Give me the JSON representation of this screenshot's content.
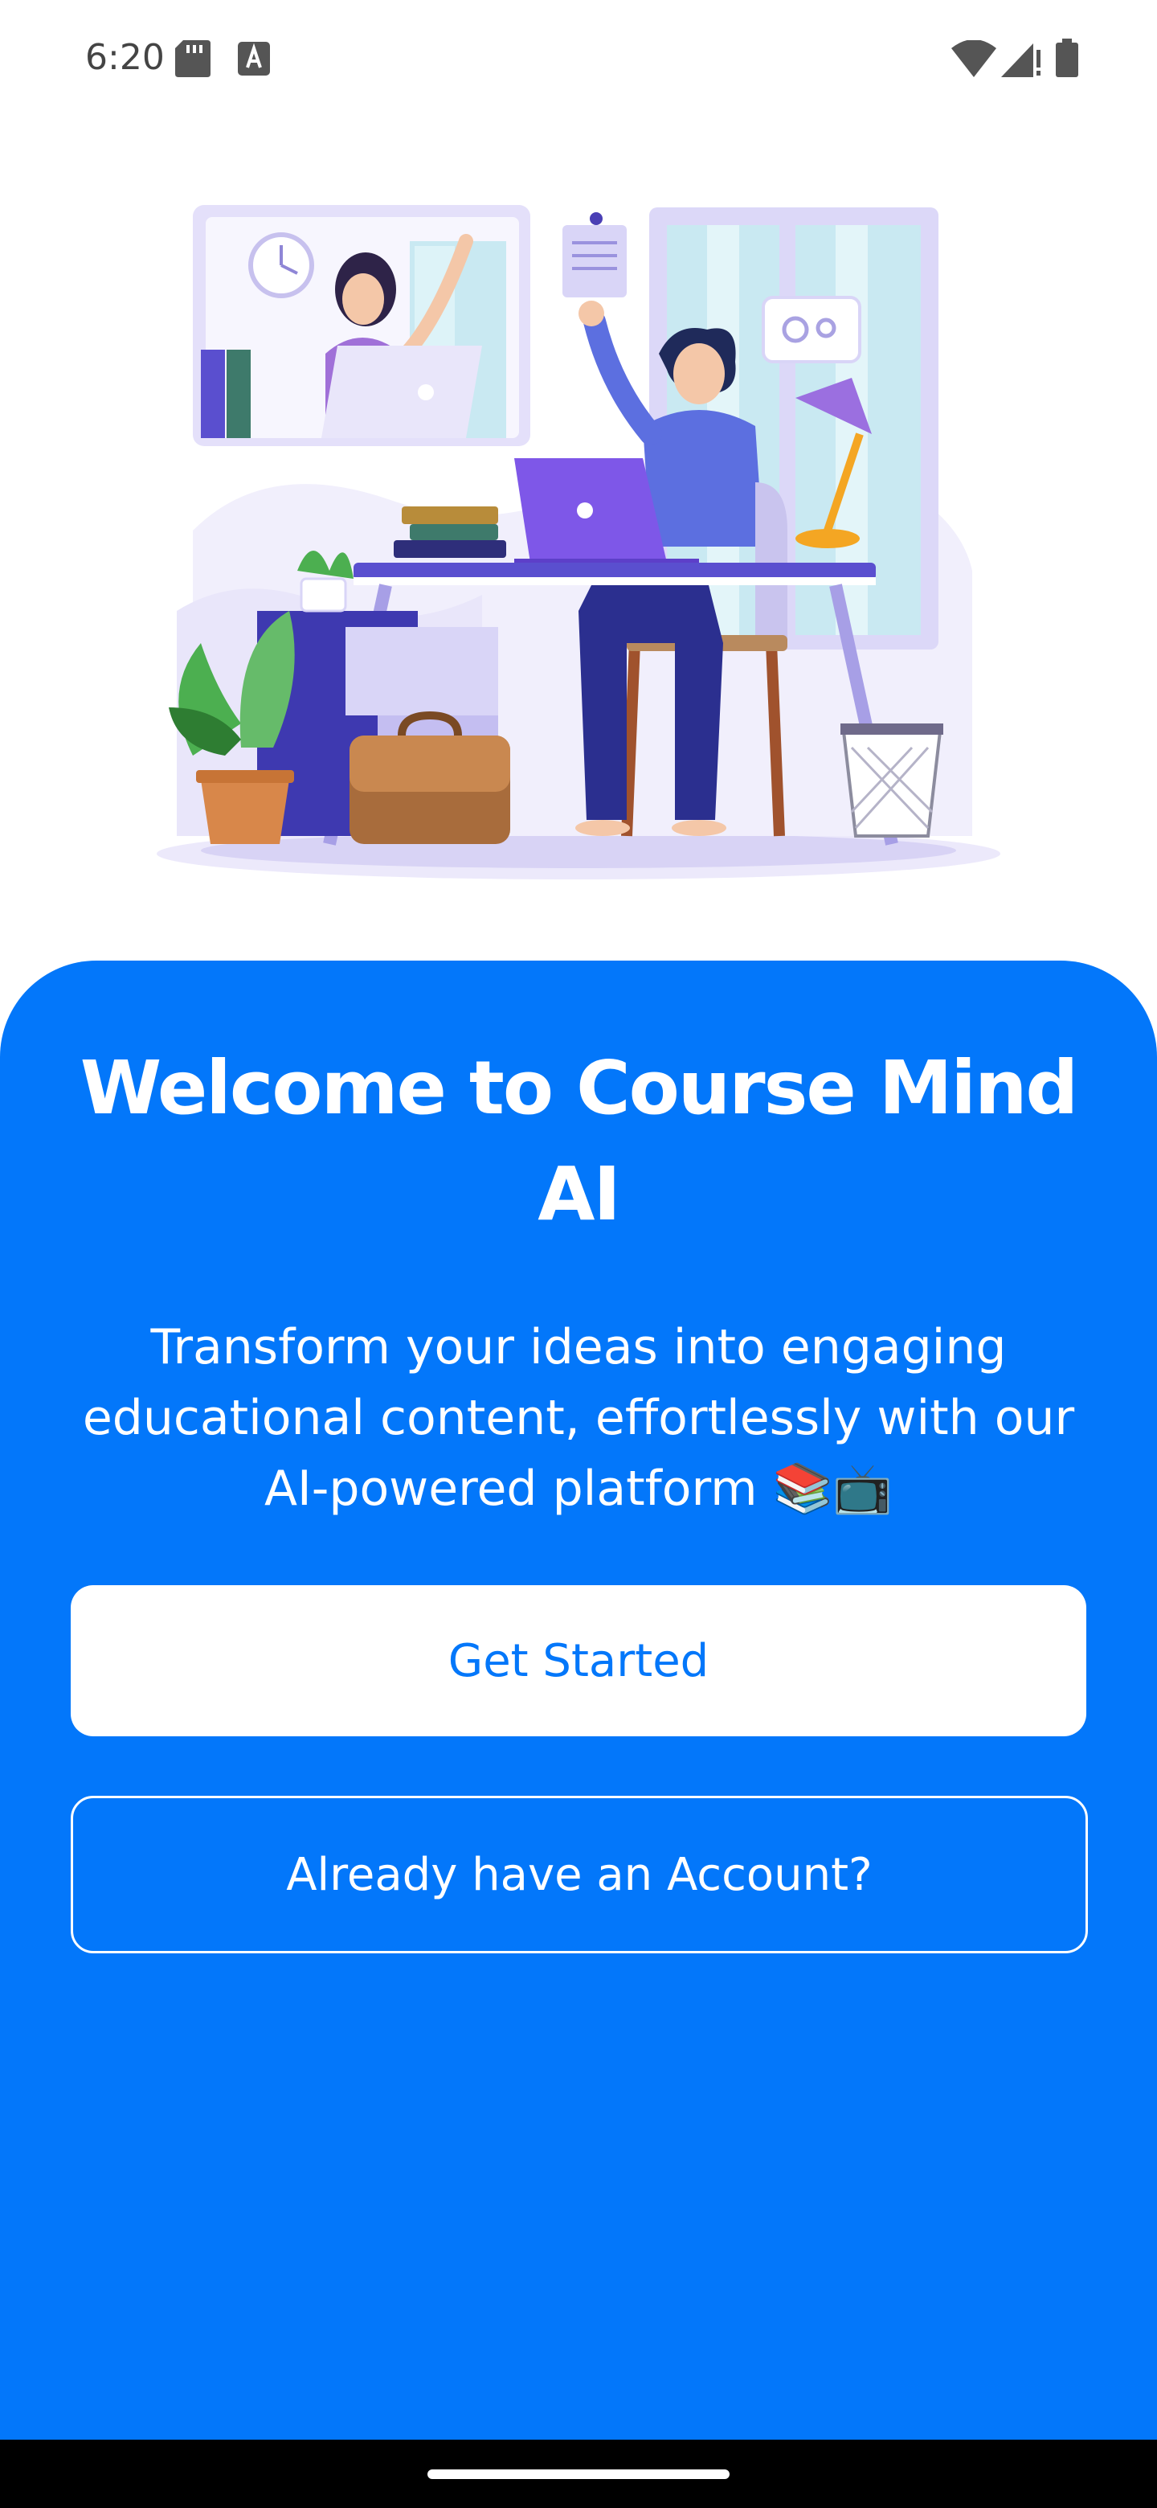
{
  "status_bar": {
    "time": "6:20",
    "icons": [
      "sd-card-icon",
      "keyboard-a-icon",
      "wifi-icon",
      "cell-signal-icon",
      "battery-icon"
    ]
  },
  "hero": {
    "illustration": "remote-video-call-illustration"
  },
  "welcome": {
    "title": "Welcome to Course Mind AI",
    "subtitle": "Transform your ideas into engaging educational content, effortlessly with our AI-powered platform 📚📺"
  },
  "actions": {
    "get_started_label": "Get Started",
    "login_label": "Already have an Account?"
  },
  "colors": {
    "primary": "#0377FA",
    "on_primary": "#FFFFFF"
  }
}
